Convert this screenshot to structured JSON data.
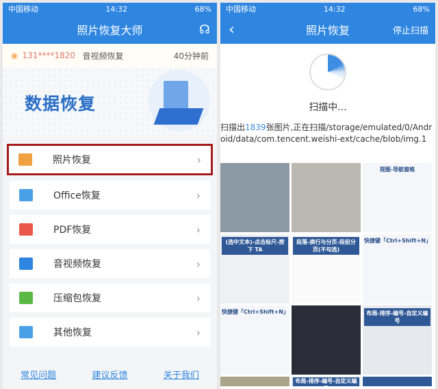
{
  "left": {
    "status": {
      "carrier": "中国移动",
      "time": "14:32",
      "battery": "68%"
    },
    "header": {
      "title": "照片恢复大师",
      "support_icon": "headset-icon"
    },
    "ticker": {
      "phone": "131****1820",
      "action": "音视频恢复",
      "time": "40分钟前"
    },
    "banner": {
      "title": "数据恢复"
    },
    "items": [
      {
        "label": "照片恢复",
        "icon": "photo-icon",
        "color": "#f0a040",
        "selected": true
      },
      {
        "label": "Office恢复",
        "icon": "office-icon",
        "color": "#4aa0e6"
      },
      {
        "label": "PDF恢复",
        "icon": "pdf-icon",
        "color": "#e9584a"
      },
      {
        "label": "音视频恢复",
        "icon": "video-icon",
        "color": "#2f86e0"
      },
      {
        "label": "压缩包恢复",
        "icon": "zip-icon",
        "color": "#5ab845"
      },
      {
        "label": "其他恢复",
        "icon": "apps-icon",
        "color": "#4aa0e6"
      }
    ],
    "footer": [
      "常见问题",
      "建议反馈",
      "关于我们"
    ]
  },
  "right": {
    "status": {
      "carrier": "中国移动",
      "time": "14:32",
      "battery": "68%"
    },
    "header": {
      "title": "照片恢复",
      "stop": "停止扫描"
    },
    "scanning": "扫描中...",
    "path_prefix": "扫描出",
    "count": "1839",
    "path_suffix": "张图片,正在扫描/storage/emulated/0/Android/data/com.tencent.weishi-ext/cache/blob/img.1",
    "thumbs": [
      {
        "cap": "",
        "bg": "#8c9aa6"
      },
      {
        "cap": "",
        "bg": "#b9b8b0"
      },
      {
        "cap": "视图-导航窗格",
        "bg": "#f4f6f9",
        "style": "dark"
      },
      {
        "cap": "(选中文本)-点击标尺-按下 TA",
        "bg": "#eef0f3",
        "style": "bar"
      },
      {
        "cap": "段落-换行与分页-段前分页(不勾选)",
        "bg": "#fafafa",
        "style": "bar"
      },
      {
        "cap": "快捷键「Ctrl+Shift+N」",
        "bg": "#f4f6f9",
        "style": "dark"
      },
      {
        "cap": "快捷键「Ctrl+Shift+N」",
        "bg": "#f4f6f9",
        "style": "dark"
      },
      {
        "cap": "",
        "bg": "#2a2c38"
      },
      {
        "cap": "布局-排序-编号-自定义编号",
        "bg": "#e6e9ee",
        "style": "bar"
      },
      {
        "cap": "",
        "bg": "#a9a48a"
      },
      {
        "cap": "布局-排序-编号-自定义编号",
        "bg": "#e6e9ee",
        "style": "bar"
      },
      {
        "cap": "",
        "bg": "#2f5896"
      }
    ]
  }
}
